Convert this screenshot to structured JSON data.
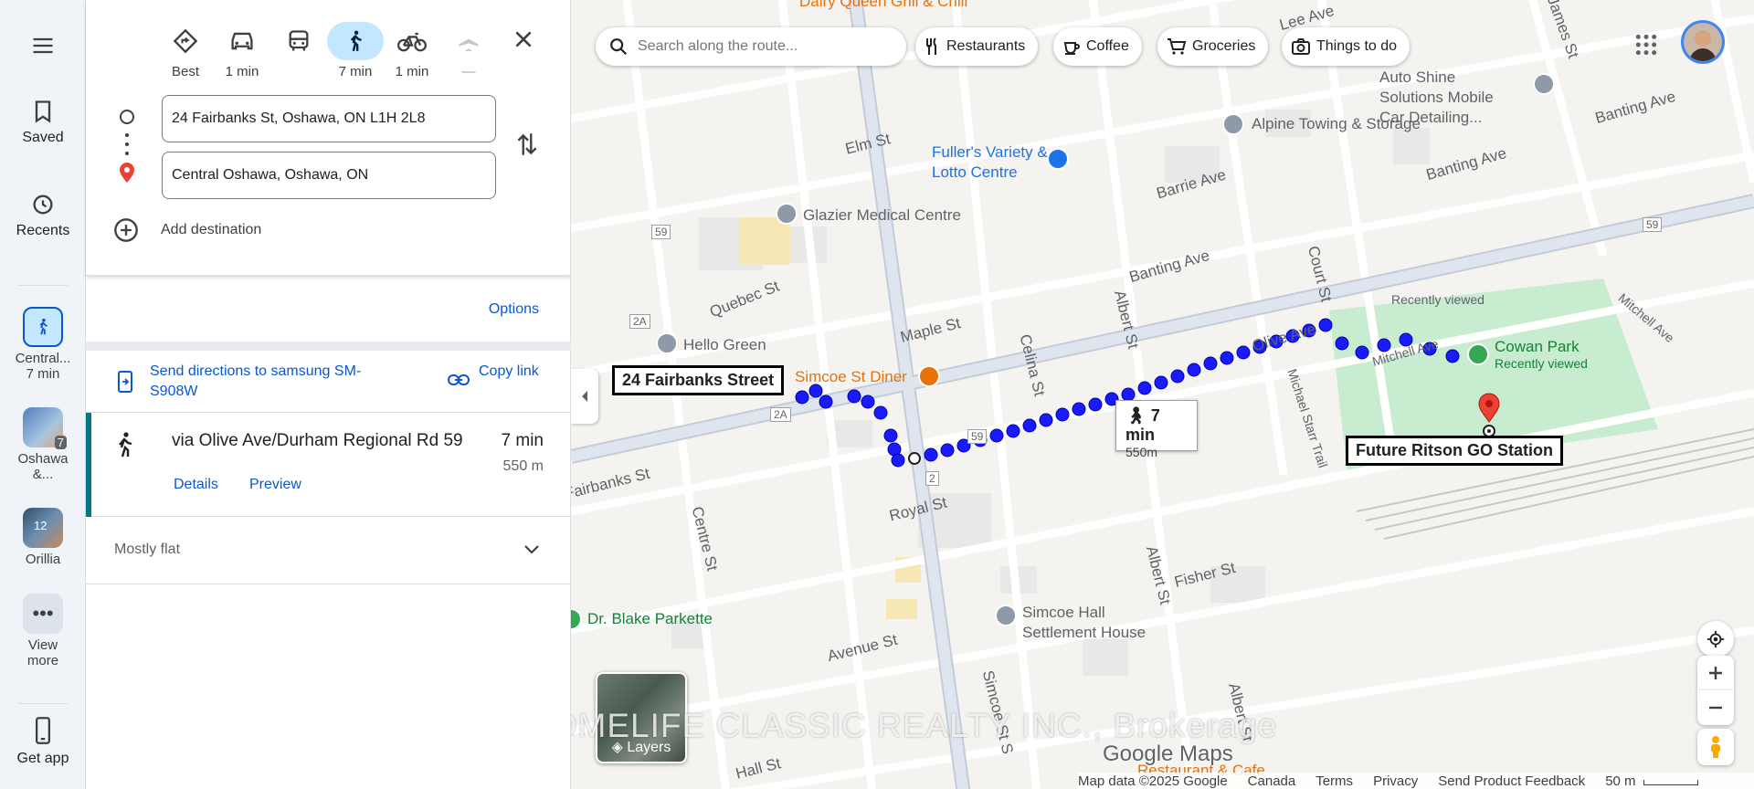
{
  "rail": {
    "saved_label": "Saved",
    "recents_label": "Recents",
    "recent_items": [
      {
        "label": "Central...",
        "sub": "7 min",
        "badge": ""
      },
      {
        "label": "Oshawa",
        "sub": "&...",
        "badge": "7"
      },
      {
        "label": "Orillia",
        "sub": "",
        "badge": "12"
      }
    ],
    "view_more_label": "View more",
    "get_app_label": "Get app"
  },
  "travel_modes": [
    {
      "name": "Best",
      "time": "Best",
      "icon": "diamond-route-icon"
    },
    {
      "name": "Driving",
      "time": "1 min",
      "icon": "car-icon"
    },
    {
      "name": "Transit",
      "time": "",
      "icon": "bus-icon"
    },
    {
      "name": "Walking",
      "time": "7 min",
      "icon": "walk-icon",
      "active": true
    },
    {
      "name": "Cycling",
      "time": "1 min",
      "icon": "bike-icon"
    },
    {
      "name": "Flights",
      "time": "—",
      "icon": "plane-icon",
      "disabled": true
    }
  ],
  "directions": {
    "origin": "24 Fairbanks St, Oshawa, ON L1H 2L8",
    "destination": "Central Oshawa, Oshawa, ON",
    "add_destination": "Add destination",
    "options_label": "Options",
    "send_label": "Send directions to samsung SM-S908W",
    "copy_link_label": "Copy link",
    "route": {
      "via": "via Olive Ave/Durham Regional Rd 59",
      "time": "7 min",
      "distance": "550 m",
      "details_label": "Details",
      "preview_label": "Preview"
    },
    "elevation": "Mostly flat"
  },
  "map": {
    "search_placeholder": "Search along the route...",
    "chips": [
      "Restaurants",
      "Coffee",
      "Groceries",
      "Things to do"
    ],
    "streets": [
      "Elm St",
      "Quebec St",
      "Maple St",
      "Celina St",
      "Albert St",
      "Court St",
      "Olive Ave",
      "Barrie Ave",
      "Banting Ave",
      "Banting Ave",
      "Banting Ave",
      "Royal St",
      "Centre St",
      "Simcoe St S",
      "Avenue St",
      "Fisher St",
      "Albert St",
      "Albert St",
      "Michael Starr Trail",
      "Mitchell Ave",
      "Mitchell Ave",
      "Hall St",
      "Fairbanks St",
      "Lee Ave",
      "James St"
    ],
    "pois": [
      "Dairy Queen Grill & Chill",
      "Auto Shine Solutions Mobile Car Detailing...",
      "Alpine Towing & Storage",
      "Fuller's Variety & Lotto Centre",
      "Glazier Medical Centre",
      "Hello Green",
      "Simcoe St Diner",
      "Cowan Park",
      "Recently viewed",
      "Recently viewed",
      "Simcoe Hall Settlement House",
      "Dr. Blake Parkette",
      "Restaurant & Cafe"
    ],
    "road_shields": [
      "59",
      "59",
      "59",
      "2A",
      "2A",
      "2"
    ],
    "origin_callout": "24 Fairbanks Street",
    "destination_callout": "Future Ritson GO Station",
    "walk_time": "7 min",
    "walk_distance": "550m",
    "layers_label": "Layers",
    "watermark": "HOMELIFE CLASSIC REALTY INC., Brokerage",
    "logo": "Google Maps",
    "footer": [
      "Map data ©2025 Google",
      "Canada",
      "Terms",
      "Privacy",
      "Send Product Feedback",
      "50 m"
    ],
    "route_color": "#1a1aff",
    "park_color": "#c8ecd0",
    "destination_pin_color": "#ea4335"
  }
}
